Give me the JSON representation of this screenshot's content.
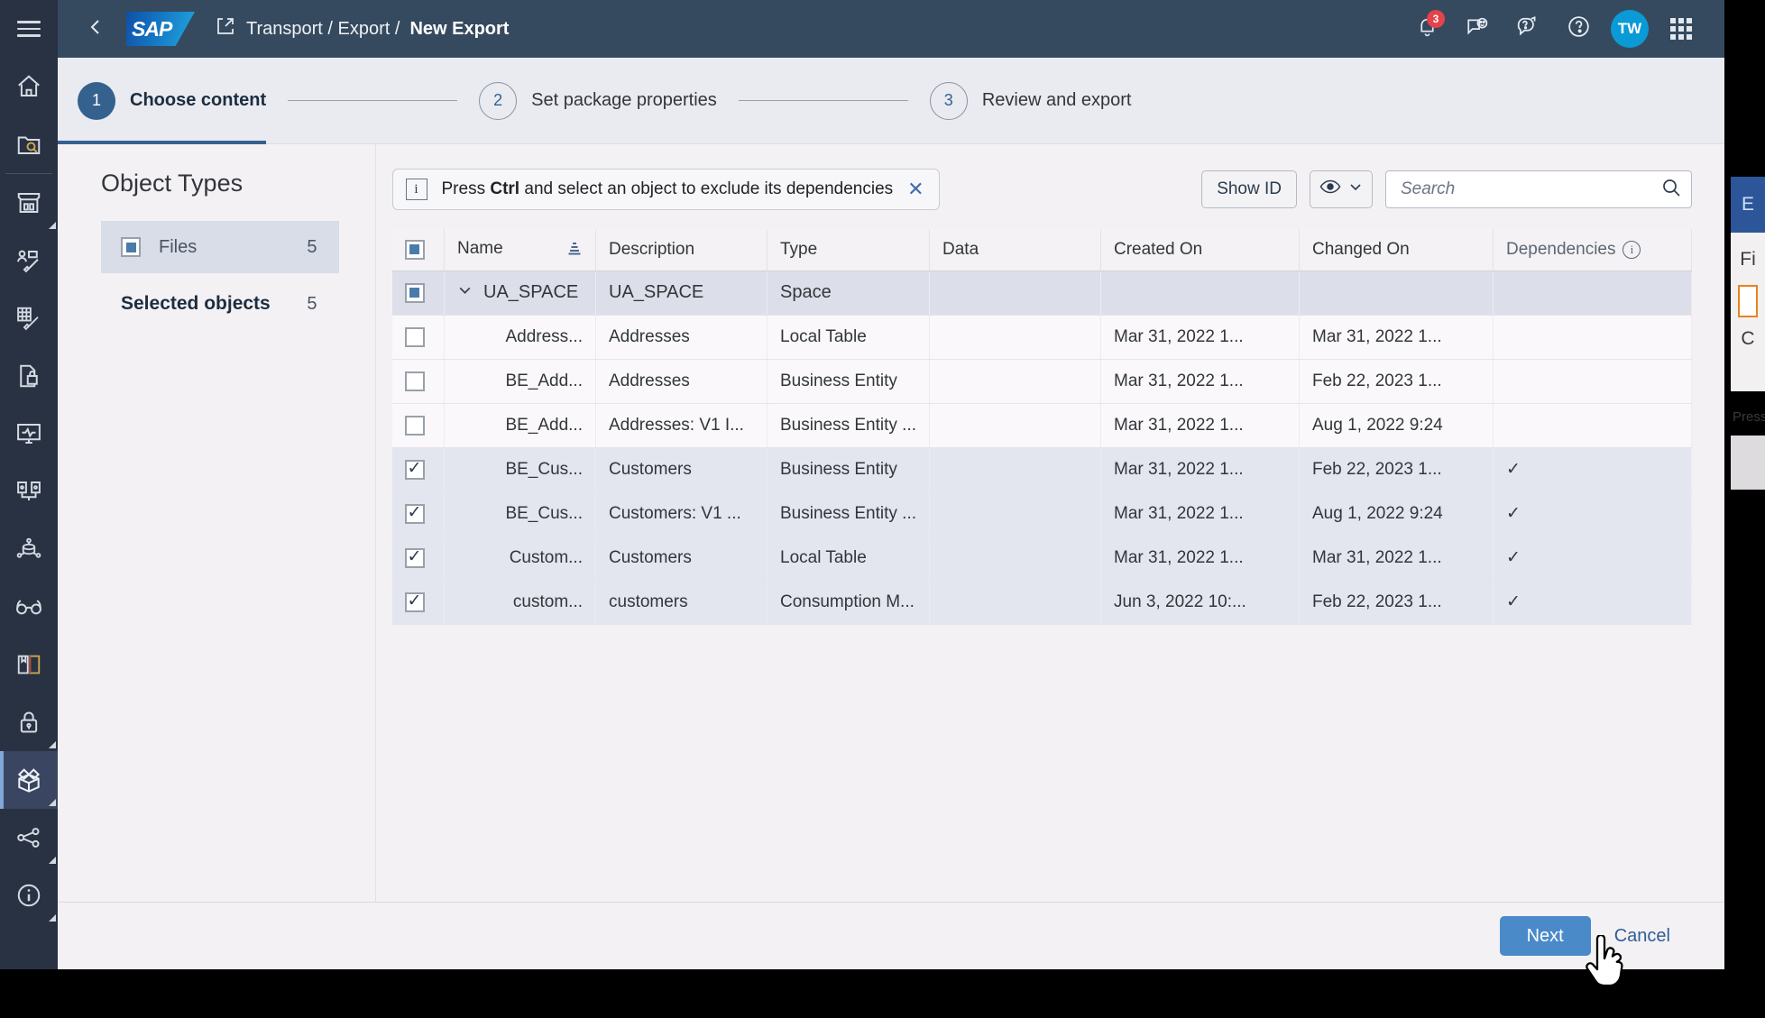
{
  "shell": {
    "back_icon": "chevron-left-icon",
    "logo_text": "SAP",
    "breadcrumb_prefix": "Transport / Export / ",
    "breadcrumb_current": "New Export",
    "share_icon": "export-share-icon",
    "notifications_count": "3",
    "avatar_initials": "TW",
    "icons": [
      "bell-icon",
      "feedback-smiley-icon",
      "question-chat-icon",
      "help-circle-icon",
      "app-grid-icon"
    ]
  },
  "rail": {
    "menu_icon": "hamburger-menu-icon",
    "items": [
      {
        "name": "home-icon"
      },
      {
        "name": "catalog-search-icon"
      },
      {
        "name": "store-icon"
      },
      {
        "name": "data-builder-icon"
      },
      {
        "name": "business-builder-icon"
      },
      {
        "name": "file-lock-icon"
      },
      {
        "name": "system-monitor-icon"
      },
      {
        "name": "connections-icon"
      },
      {
        "name": "data-sharing-icon"
      },
      {
        "name": "glasses-icon"
      },
      {
        "name": "book-icon"
      },
      {
        "name": "security-lock-icon"
      },
      {
        "name": "transport-package-icon"
      },
      {
        "name": "share-node-icon"
      },
      {
        "name": "info-circle-icon"
      }
    ]
  },
  "wizard": {
    "steps": [
      {
        "number": "1",
        "label": "Choose content",
        "state": "current"
      },
      {
        "number": "2",
        "label": "Set package properties",
        "state": "upcoming"
      },
      {
        "number": "3",
        "label": "Review and export",
        "state": "upcoming"
      }
    ]
  },
  "object_types": {
    "title": "Object Types",
    "rows": [
      {
        "label": "Files",
        "count": "5",
        "selected": true
      }
    ],
    "selected_label": "Selected objects",
    "selected_count": "5"
  },
  "toolbar": {
    "message_prefix": "Press ",
    "message_bold": "Ctrl",
    "message_suffix": " and select an object to exclude its dependencies",
    "info_glyph": "i",
    "close_glyph": "✕",
    "show_id_label": "Show ID",
    "view_icon": "eye-icon",
    "view_chevron": "chevron-down-icon",
    "search_placeholder": "Search",
    "search_value": "",
    "search_icon": "search-icon"
  },
  "table": {
    "columns": [
      {
        "key": "check",
        "label": ""
      },
      {
        "key": "name",
        "label": "Name"
      },
      {
        "key": "description",
        "label": "Description"
      },
      {
        "key": "type",
        "label": "Type"
      },
      {
        "key": "data",
        "label": "Data"
      },
      {
        "key": "created",
        "label": "Created On"
      },
      {
        "key": "changed",
        "label": "Changed On"
      },
      {
        "key": "dependencies",
        "label": "Dependencies"
      }
    ],
    "sort_icon": "group-sort-icon",
    "dependencies_info_icon": "info-icon",
    "group": {
      "check_state": "partial",
      "expand_icon": "chevron-down-icon",
      "name": "UA_SPACE",
      "description": "UA_SPACE",
      "type": "Space",
      "data": "",
      "created": "",
      "changed": "",
      "dependencies": ""
    },
    "rows": [
      {
        "checked": false,
        "name": "Address...",
        "description": "Addresses",
        "type": "Local Table",
        "data": "",
        "created": "Mar 31, 2022 1...",
        "changed": "Mar 31, 2022 1...",
        "dependencies": ""
      },
      {
        "checked": false,
        "name": "BE_Add...",
        "description": "Addresses",
        "type": "Business Entity",
        "data": "",
        "created": "Mar 31, 2022 1...",
        "changed": "Feb 22, 2023 1...",
        "dependencies": ""
      },
      {
        "checked": false,
        "name": "BE_Add...",
        "description": "Addresses: V1 I...",
        "type": "Business Entity ...",
        "data": "",
        "created": "Mar 31, 2022 1...",
        "changed": "Aug 1, 2022 9:24",
        "dependencies": ""
      },
      {
        "checked": true,
        "name": "BE_Cus...",
        "description": "Customers",
        "type": "Business Entity",
        "data": "",
        "created": "Mar 31, 2022 1...",
        "changed": "Feb 22, 2023 1...",
        "dependencies": "✓"
      },
      {
        "checked": true,
        "name": "BE_Cus...",
        "description": "Customers: V1 ...",
        "type": "Business Entity ...",
        "data": "",
        "created": "Mar 31, 2022 1...",
        "changed": "Aug 1, 2022 9:24",
        "dependencies": "✓"
      },
      {
        "checked": true,
        "name": "Custom...",
        "description": "Customers",
        "type": "Local Table",
        "data": "",
        "created": "Mar 31, 2022 1...",
        "changed": "Mar 31, 2022 1...",
        "dependencies": "✓"
      },
      {
        "checked": true,
        "name": "custom...",
        "description": "customers",
        "type": "Consumption M...",
        "data": "",
        "created": "Jun 3, 2022 10:...",
        "changed": "Feb 22, 2023 1...",
        "dependencies": "✓"
      }
    ]
  },
  "footer": {
    "next_label": "Next",
    "cancel_label": "Cancel"
  },
  "right_panel": {
    "header_text": "E",
    "line1": "Fi",
    "line2": "C",
    "line3": "Press"
  },
  "colors": {
    "shell_bg": "#354a5f",
    "rail_bg": "#283243",
    "accent_blue": "#34618e",
    "primary_button": "#4a8ac9",
    "badge_red": "#e4434b",
    "avatar_blue": "#0a9ad6",
    "dependency_check": "#1f4e85",
    "field_orange": "#e8821e"
  }
}
